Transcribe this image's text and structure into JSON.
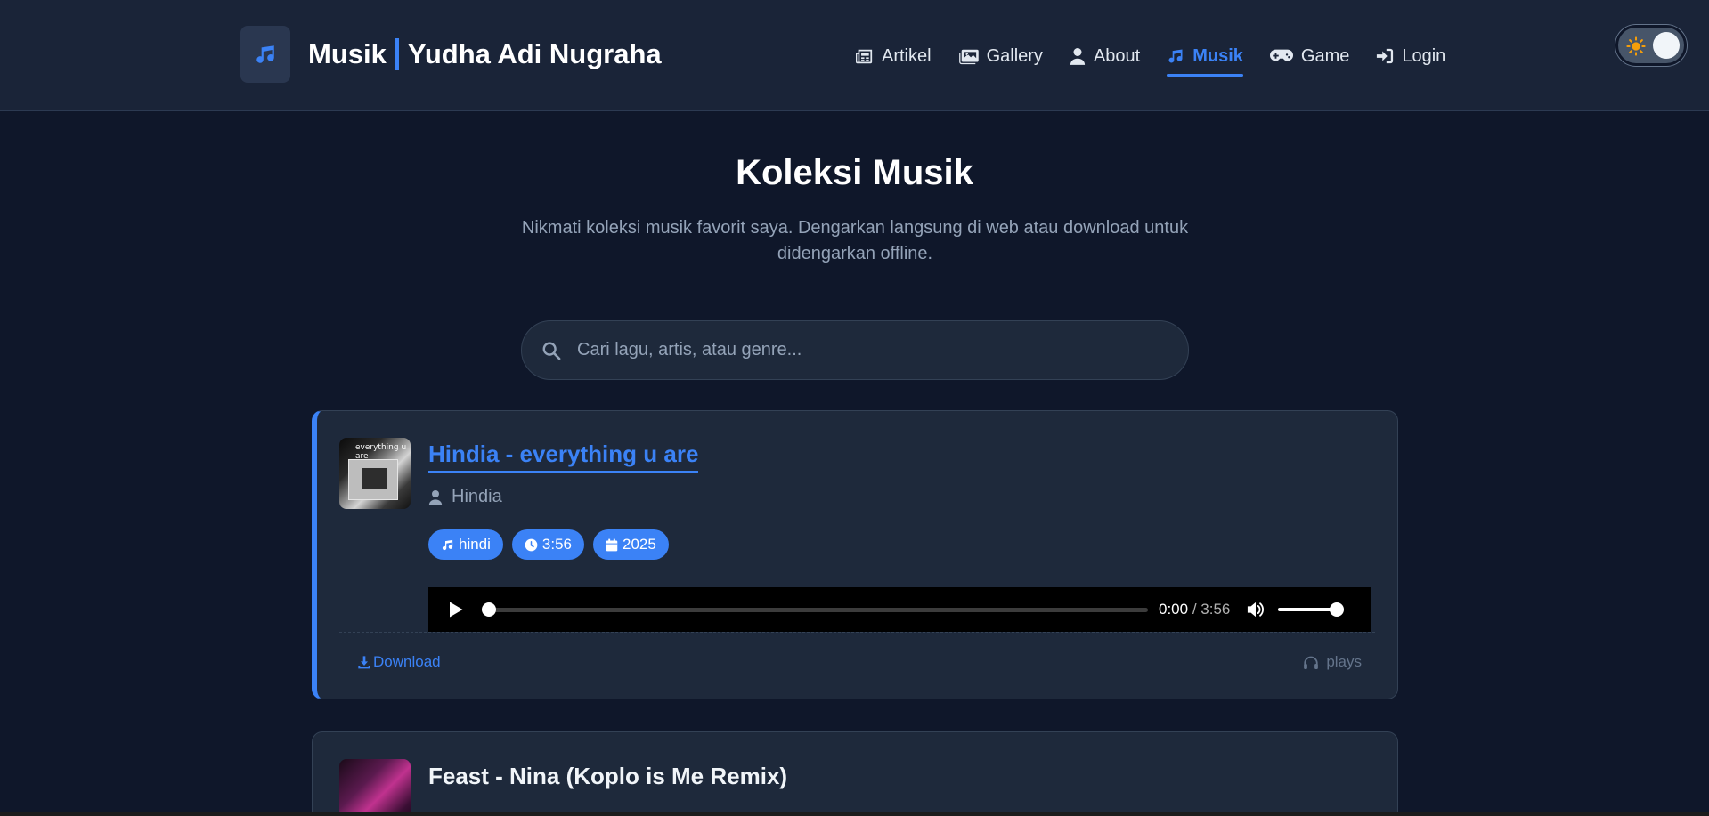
{
  "colors": {
    "accent": "#3b82f6",
    "background": "#0f172a",
    "card": "#1e293b"
  },
  "brand": {
    "icon": "music-note-icon",
    "title": "Musik",
    "name": "Yudha Adi Nugraha"
  },
  "nav": {
    "items": [
      {
        "label": "Artikel",
        "icon": "newspaper-icon"
      },
      {
        "label": "Gallery",
        "icon": "images-icon"
      },
      {
        "label": "About",
        "icon": "user-icon"
      },
      {
        "label": "Musik",
        "icon": "music-note-icon",
        "active": true
      },
      {
        "label": "Game",
        "icon": "gamepad-icon"
      },
      {
        "label": "Login",
        "icon": "sign-in-icon"
      }
    ]
  },
  "theme_toggle": {
    "icon_light": "sun-icon",
    "icon_dark": "moon-icon",
    "mode": "dark"
  },
  "hero": {
    "title": "Koleksi Musik",
    "subtitle": "Nikmati koleksi musik favorit saya. Dengarkan langsung di web atau download untuk didengarkan offline."
  },
  "search": {
    "placeholder": "Cari lagu, artis, atau genre...",
    "value": ""
  },
  "songs": [
    {
      "title": "Hindia - everything u are",
      "artist": "Hindia",
      "cover_text": "everything u are",
      "genre": "hindi",
      "duration": "3:56",
      "year": "2025",
      "player": {
        "current": "0:00",
        "separator": "/",
        "total": "3:56",
        "progress": 0,
        "volume": 1.0
      },
      "download_label": "Download",
      "plays_label": "plays"
    },
    {
      "title": "Feast - Nina (Koplo is Me Remix)"
    }
  ]
}
